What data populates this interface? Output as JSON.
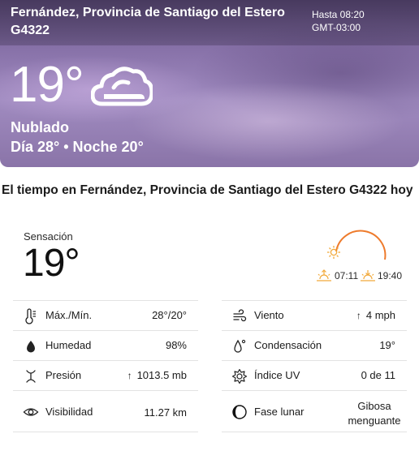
{
  "hero": {
    "location_line1": "Fernández, Provincia de Santiago del Estero",
    "location_line2": "G4322",
    "until": "Hasta 08:20",
    "timezone": "GMT-03:00",
    "temperature": "19°",
    "condition": "Nublado",
    "day_night": "Día 28° • Noche 20°",
    "condition_icon": "cloud-icon"
  },
  "details": {
    "title": "El tiempo en Fernández, Provincia de Santiago del Estero G4322 hoy",
    "feels_like_label": "Sensación",
    "feels_like_value": "19°",
    "sunrise": "07:11",
    "sunset": "19:40",
    "sun_color": "#f29d2a"
  },
  "left_rows": [
    {
      "icon": "thermometer-icon",
      "label": "Máx./Mín.",
      "value": "28°/20°"
    },
    {
      "icon": "humidity-drop-icon",
      "label": "Humedad",
      "value": "98%"
    },
    {
      "icon": "pressure-icon",
      "label": "Presión",
      "arrow": "↑",
      "value": "1013.5 mb"
    },
    {
      "icon": "eye-icon",
      "label": "Visibilidad",
      "value": "11.27 km"
    }
  ],
  "right_rows": [
    {
      "icon": "wind-icon",
      "label": "Viento",
      "arrow": "↑",
      "value": "4 mph"
    },
    {
      "icon": "dew-point-icon",
      "label": "Condensación",
      "value": "19°"
    },
    {
      "icon": "uv-index-icon",
      "label": "Índice UV",
      "value": "0 de 11"
    },
    {
      "icon": "moon-phase-icon",
      "label": "Fase lunar",
      "value_line1": "Gibosa",
      "value_line2": "menguante"
    }
  ]
}
